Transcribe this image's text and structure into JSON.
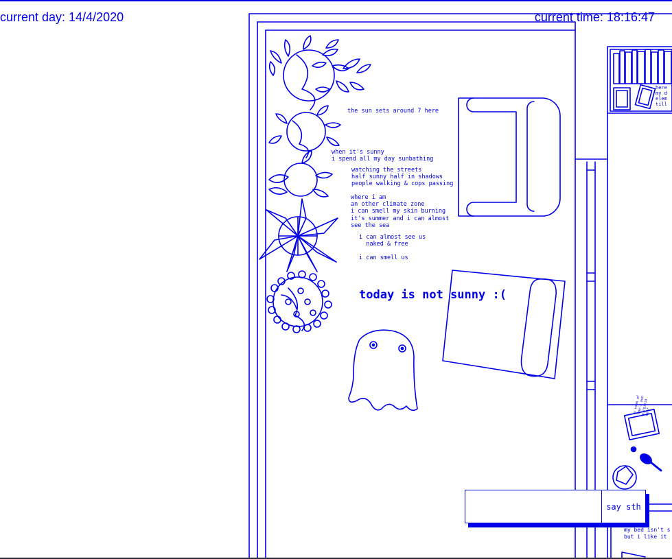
{
  "header": {
    "current_day": "current day: 14/4/2020",
    "current_time": "current time: 18:16:47"
  },
  "poem": {
    "line_1": "the sun sets around 7 here",
    "block_2": "when it's sunny\ni spend all my day sunbathing",
    "block_3": "watching the streets\nhalf sunny half in shadows\npeople walking & cops passing",
    "block_4": "where i am\nan other climate zone\ni can smell my skin burning\nit's summer and i can almost\nsee the sea",
    "block_5": "i can almost see us\n  naked & free",
    "block_6": "i can smell us"
  },
  "status_text": "today is not sunny :(",
  "side_notes": {
    "shelf_note": "here\nmy d\nelem\ntill",
    "book_note": "a room of\none's own\nvirginia\nwolf",
    "bed_note": "my bed isn't s\nbut i like it"
  },
  "chat": {
    "placeholder": "",
    "button_label": "say sth"
  },
  "colors": {
    "ink": "#0000e6",
    "background": "#ffffff"
  }
}
